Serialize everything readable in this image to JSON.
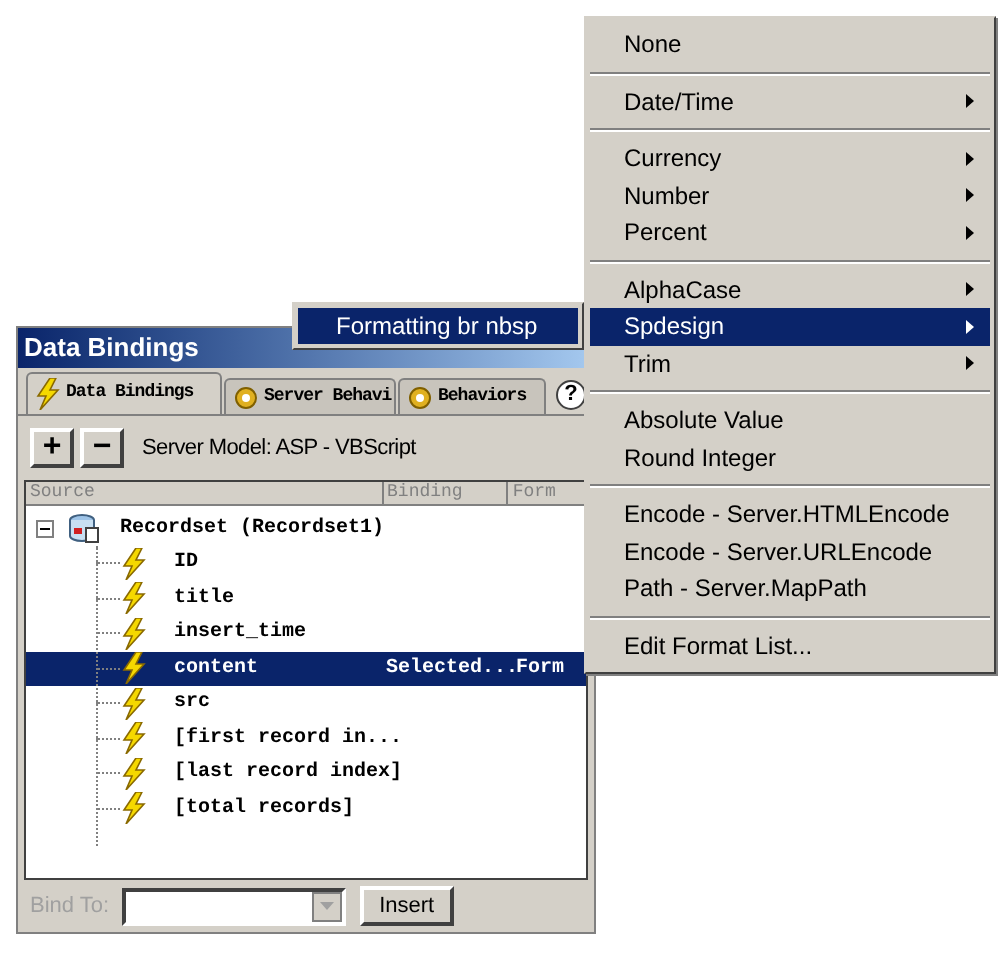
{
  "panel": {
    "title": "Data Bindings",
    "tabs": [
      {
        "label": "Data Bindings",
        "selected": true
      },
      {
        "label": "Server Behavi",
        "selected": false
      },
      {
        "label": "Behaviors",
        "selected": false
      }
    ],
    "help": "?",
    "toolbar": {
      "add": "+",
      "remove": "−",
      "server_model": "Server Model: ASP - VBScript"
    },
    "table": {
      "columns": [
        "Source",
        "Binding",
        "Form"
      ],
      "root": {
        "label": "Recordset (Recordset1)",
        "expanded": true,
        "children": [
          {
            "label": "ID",
            "selected": false
          },
          {
            "label": "title",
            "selected": false
          },
          {
            "label": "insert_time",
            "selected": false
          },
          {
            "label": "content",
            "binding": "Selected...",
            "format": "Form",
            "selected": true
          },
          {
            "label": "src",
            "selected": false
          },
          {
            "label": "[first record in...",
            "selected": false
          },
          {
            "label": "[last record index]",
            "selected": false
          },
          {
            "label": "[total records]",
            "selected": false
          }
        ]
      }
    },
    "bind_to": {
      "label": "Bind To:",
      "disabled": true
    },
    "insert_button": "Insert"
  },
  "format_menu": [
    {
      "kind": "item",
      "label": "None",
      "submenu": false,
      "selected": false
    },
    {
      "kind": "separator"
    },
    {
      "kind": "item",
      "label": "Date/Time",
      "submenu": true,
      "selected": false
    },
    {
      "kind": "separator"
    },
    {
      "kind": "item",
      "label": "Currency",
      "submenu": true,
      "selected": false
    },
    {
      "kind": "item",
      "label": "Number",
      "submenu": true,
      "selected": false
    },
    {
      "kind": "item",
      "label": "Percent",
      "submenu": true,
      "selected": false
    },
    {
      "kind": "separator"
    },
    {
      "kind": "item",
      "label": "AlphaCase",
      "submenu": true,
      "selected": false
    },
    {
      "kind": "item",
      "label": "Spdesign",
      "submenu": true,
      "selected": true
    },
    {
      "kind": "item",
      "label": "Trim",
      "submenu": true,
      "selected": false
    },
    {
      "kind": "separator"
    },
    {
      "kind": "item",
      "label": "Absolute Value",
      "submenu": false,
      "selected": false
    },
    {
      "kind": "item",
      "label": "Round Integer",
      "submenu": false,
      "selected": false
    },
    {
      "kind": "separator"
    },
    {
      "kind": "item",
      "label": "Encode - Server.HTMLEncode",
      "submenu": false,
      "selected": false
    },
    {
      "kind": "item",
      "label": "Encode - Server.URLEncode",
      "submenu": false,
      "selected": false
    },
    {
      "kind": "item",
      "label": "Path - Server.MapPath",
      "submenu": false,
      "selected": false
    },
    {
      "kind": "separator"
    },
    {
      "kind": "item",
      "label": "Edit Format List...",
      "submenu": false,
      "selected": false
    }
  ],
  "submenu": [
    {
      "label": "Formatting br nbsp",
      "selected": true
    }
  ]
}
